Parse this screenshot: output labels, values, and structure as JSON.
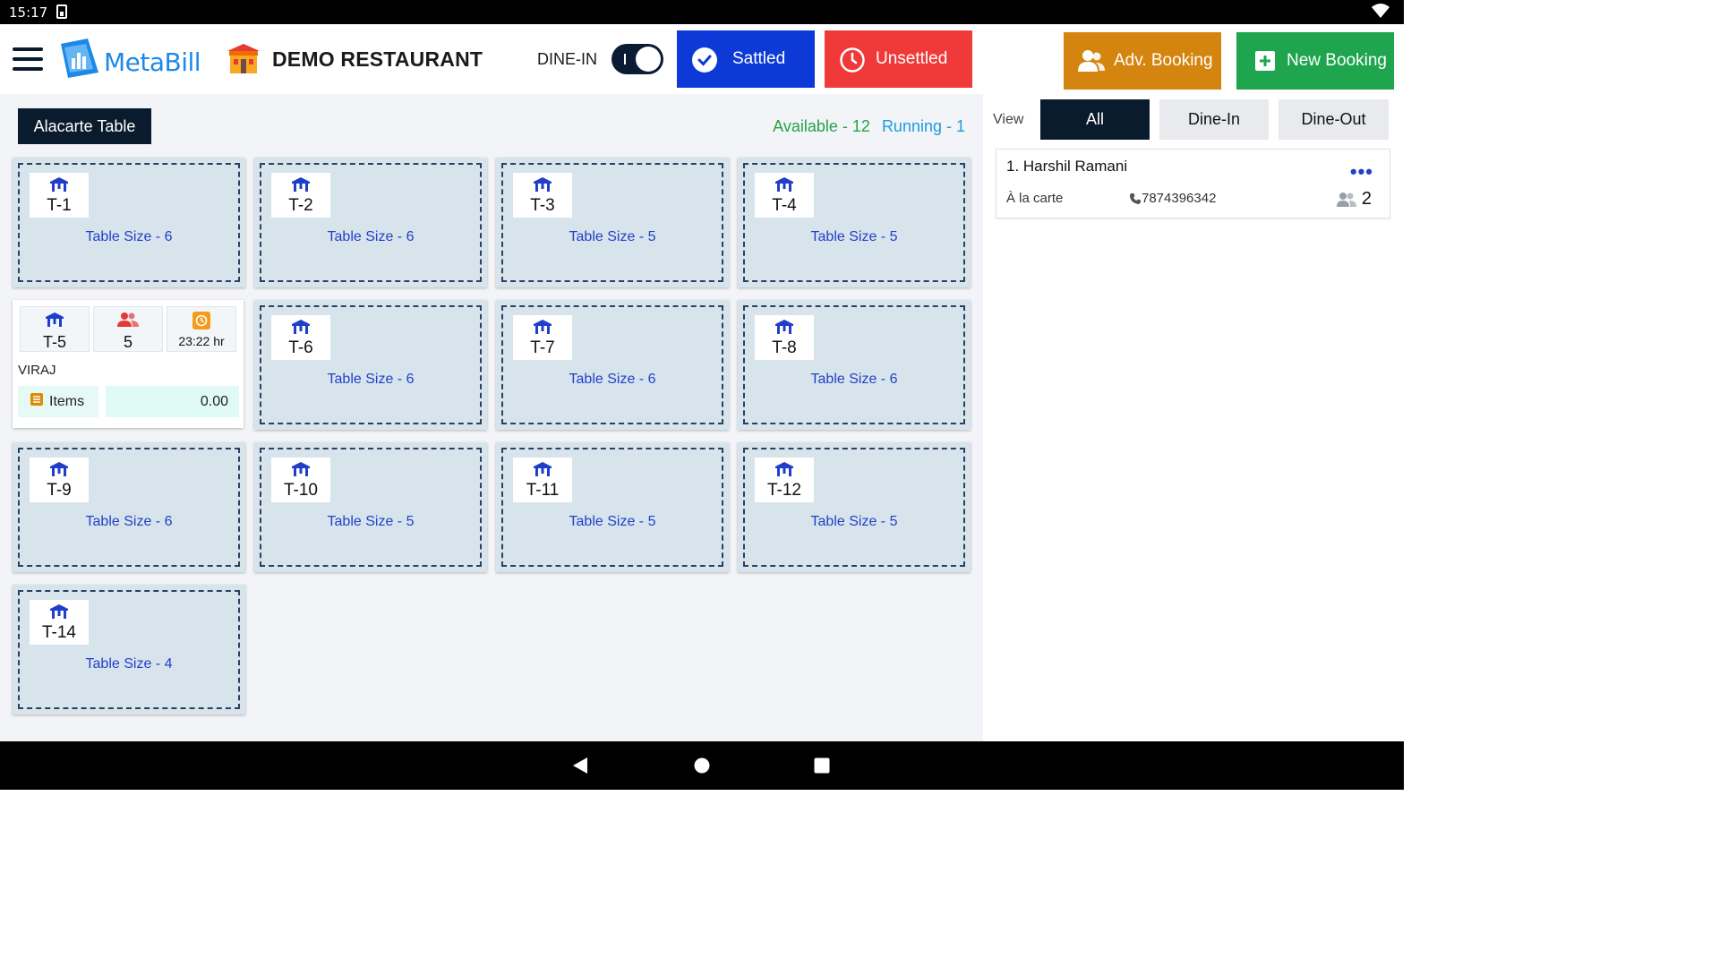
{
  "status_bar": {
    "time": "15:17"
  },
  "header": {
    "menu_icon": "hamburger-menu-icon",
    "brand": "MetaBill",
    "restaurant_name": "DEMO RESTAURANT",
    "mode_label": "DINE-IN",
    "toggle_on": true,
    "sattled_label": "Sattled",
    "unsettled_label": "Unsettled",
    "adv_booking_label": "Adv. Booking",
    "new_booking_label": "New Booking",
    "colors": {
      "sattled": "#0d3ad6",
      "unsettled": "#f03a3a",
      "adv_booking": "#d4850f",
      "new_booking": "#1fa54d"
    }
  },
  "main": {
    "section_label": "Alacarte Table",
    "available_text": "Available - 12",
    "running_text": "Running - 1",
    "tables": [
      {
        "name": "T-1",
        "size": "Table Size - 6"
      },
      {
        "name": "T-2",
        "size": "Table Size - 6"
      },
      {
        "name": "T-3",
        "size": "Table Size - 5"
      },
      {
        "name": "T-4",
        "size": "Table Size - 5"
      },
      {
        "name": "T-6",
        "size": "Table Size - 6"
      },
      {
        "name": "T-7",
        "size": "Table Size - 6"
      },
      {
        "name": "T-8",
        "size": "Table Size - 6"
      },
      {
        "name": "T-9",
        "size": "Table Size - 6"
      },
      {
        "name": "T-10",
        "size": "Table Size - 5"
      },
      {
        "name": "T-11",
        "size": "Table Size - 5"
      },
      {
        "name": "T-12",
        "size": "Table Size - 5"
      },
      {
        "name": "T-14",
        "size": "Table Size - 4"
      }
    ],
    "running_table": {
      "name": "T-5",
      "guests": "5",
      "time": "23:22 hr",
      "customer": "VIRAJ",
      "items_label": "Items",
      "amount": "0.00"
    }
  },
  "right_panel": {
    "view_label": "View",
    "filters": [
      "All",
      "Dine-In",
      "Dine-Out"
    ],
    "active_filter": "All",
    "bookings": [
      {
        "name": "1. Harshil Ramani",
        "type": "À la carte",
        "phone": "7874396342",
        "guests": "2"
      }
    ]
  }
}
